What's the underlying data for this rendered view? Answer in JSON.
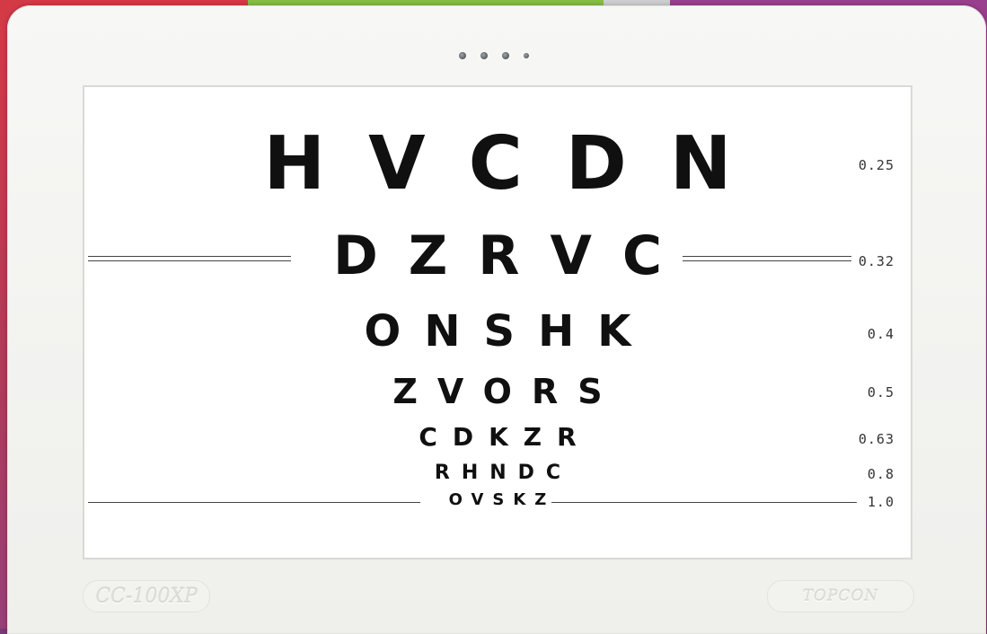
{
  "device": {
    "model_badge": "CC-100XP",
    "brand_badge": "TOPCON"
  },
  "chart": {
    "rows": [
      {
        "letters": "HVCDN",
        "acuity": "0.25"
      },
      {
        "letters": "DZRVC",
        "acuity": "0.32"
      },
      {
        "letters": "ONSHK",
        "acuity": "0.4"
      },
      {
        "letters": "ZVORS",
        "acuity": "0.5"
      },
      {
        "letters": "CDKZR",
        "acuity": "0.63"
      },
      {
        "letters": "RHNDC",
        "acuity": "0.8"
      },
      {
        "letters": "OVSKZ",
        "acuity": "1.0"
      }
    ]
  },
  "colors": {
    "background_left": "#d43a45",
    "background_top_mid": "#86bf42",
    "background_right": "#9a3f8e",
    "housing": "#f4f4f1",
    "screen": "#ffffff",
    "optotype": "#101010"
  }
}
